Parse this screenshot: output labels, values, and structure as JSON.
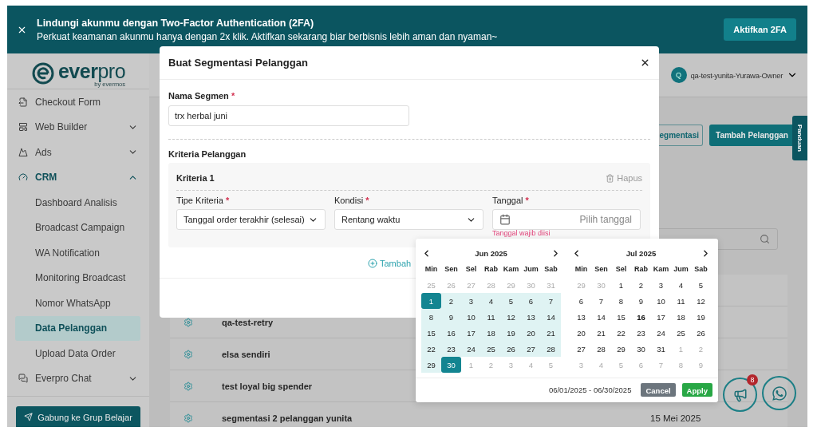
{
  "banner": {
    "title": "Lindungi akunmu dengan Two-Factor Authentication (2FA)",
    "message": "Perkuat keamanan akunmu hanya dengan 2x klik. Aktifkan sekarang biar berbisnis lebih aman dan nyaman~",
    "button": "Aktifkan 2FA"
  },
  "sidebar": {
    "logo": "**ever**pro",
    "tagline": "by evermos",
    "items": [
      {
        "kind": "link",
        "label": "Checkout Form"
      },
      {
        "kind": "group",
        "label": "Web Builder",
        "expanded": false
      },
      {
        "kind": "group",
        "label": "Ads",
        "expanded": false
      },
      {
        "kind": "group",
        "label": "CRM",
        "expanded": true,
        "children": [
          {
            "label": "Dashboard Analisis",
            "selected": false
          },
          {
            "label": "Broadcast Campaign",
            "selected": false
          },
          {
            "label": "WA Notification",
            "selected": false
          },
          {
            "label": "Monitoring Broadcast",
            "selected": false
          },
          {
            "label": "Nomor WhatsApp",
            "selected": false
          },
          {
            "label": "Data Pelanggan",
            "selected": true
          },
          {
            "label": "Upload Data Order",
            "selected": false
          }
        ]
      },
      {
        "kind": "group",
        "label": "Everpro Chat",
        "expanded": false
      }
    ],
    "join_button": "Gabung ke Grup Belajar"
  },
  "header": {
    "initial": "Q",
    "user": "qa-test-yunita-Yurawa-Owner"
  },
  "actions": [
    {
      "kind": "outline",
      "label": "egmentasi"
    },
    {
      "kind": "primary",
      "label": "Tambah Pelanggan"
    }
  ],
  "guide_tab": "Panduan",
  "rows": [
    {
      "name": "qa-test-retry"
    },
    {
      "name": "elsa sendiri"
    },
    {
      "name": "test loyal big spender"
    },
    {
      "name": "segmentasi 2 pelanggan yunita",
      "date": "15 Mei 2025"
    }
  ],
  "notification_badge": "8",
  "modal": {
    "title": "Buat Segmentasi Pelanggan",
    "name_field": {
      "label": "Nama Segmen",
      "mark": "*",
      "value": "trx herbal juni"
    },
    "criteria_title": "Kriteria Pelanggan",
    "criteria": [
      {
        "title": "Kriteria 1",
        "delete": "Hapus",
        "fields": [
          {
            "kind": "select",
            "label": "Tipe Kriteria",
            "mark": "*",
            "value": "Tanggal order terakhir (selesai)"
          },
          {
            "kind": "select",
            "label": "Kondisi",
            "mark": "*",
            "value": "Rentang waktu"
          },
          {
            "kind": "date",
            "label": "Tanggal",
            "mark": "*",
            "placeholder": "Pilih tanggal",
            "error": "Tanggal wajib diisi"
          }
        ]
      }
    ],
    "add_link": "Tambah"
  },
  "datepicker": {
    "months": [
      {
        "title": "Jun 2025",
        "weekdays": [
          "Min",
          "Sen",
          "Sel",
          "Rab",
          "Kam",
          "Jum",
          "Sab"
        ],
        "days": [
          {
            "d": "25",
            "kind": "outside"
          },
          {
            "d": "26",
            "kind": "outside"
          },
          {
            "d": "27",
            "kind": "outside"
          },
          {
            "d": "28",
            "kind": "outside"
          },
          {
            "d": "29",
            "kind": "outside"
          },
          {
            "d": "30",
            "kind": "outside"
          },
          {
            "d": "31",
            "kind": "outside"
          },
          {
            "d": "1",
            "kind": "selected"
          },
          {
            "d": "2",
            "kind": "range"
          },
          {
            "d": "3",
            "kind": "range"
          },
          {
            "d": "4",
            "kind": "range"
          },
          {
            "d": "5",
            "kind": "range"
          },
          {
            "d": "6",
            "kind": "range"
          },
          {
            "d": "7",
            "kind": "range"
          },
          {
            "d": "8",
            "kind": "range"
          },
          {
            "d": "9",
            "kind": "range"
          },
          {
            "d": "10",
            "kind": "range"
          },
          {
            "d": "11",
            "kind": "range"
          },
          {
            "d": "12",
            "kind": "range"
          },
          {
            "d": "13",
            "kind": "range"
          },
          {
            "d": "14",
            "kind": "range"
          },
          {
            "d": "15",
            "kind": "range"
          },
          {
            "d": "16",
            "kind": "range"
          },
          {
            "d": "17",
            "kind": "range"
          },
          {
            "d": "18",
            "kind": "range"
          },
          {
            "d": "19",
            "kind": "range"
          },
          {
            "d": "20",
            "kind": "range"
          },
          {
            "d": "21",
            "kind": "range"
          },
          {
            "d": "22",
            "kind": "range"
          },
          {
            "d": "23",
            "kind": "range"
          },
          {
            "d": "24",
            "kind": "range"
          },
          {
            "d": "25",
            "kind": "range"
          },
          {
            "d": "26",
            "kind": "range"
          },
          {
            "d": "27",
            "kind": "range"
          },
          {
            "d": "28",
            "kind": "range"
          },
          {
            "d": "29",
            "kind": "range"
          },
          {
            "d": "30",
            "kind": "selected"
          },
          {
            "d": "1",
            "kind": "outside"
          },
          {
            "d": "2",
            "kind": "outside"
          },
          {
            "d": "3",
            "kind": "outside"
          },
          {
            "d": "4",
            "kind": "outside"
          },
          {
            "d": "5",
            "kind": "outside"
          }
        ]
      },
      {
        "title": "Jul 2025",
        "weekdays": [
          "Min",
          "Sen",
          "Sel",
          "Rab",
          "Kam",
          "Jum",
          "Sab"
        ],
        "days": [
          {
            "d": "29",
            "kind": "outside"
          },
          {
            "d": "30",
            "kind": "outside"
          },
          {
            "d": "1",
            "kind": "normal"
          },
          {
            "d": "2",
            "kind": "normal"
          },
          {
            "d": "3",
            "kind": "normal"
          },
          {
            "d": "4",
            "kind": "normal"
          },
          {
            "d": "5",
            "kind": "normal"
          },
          {
            "d": "6",
            "kind": "normal"
          },
          {
            "d": "7",
            "kind": "normal"
          },
          {
            "d": "8",
            "kind": "normal"
          },
          {
            "d": "9",
            "kind": "normal"
          },
          {
            "d": "10",
            "kind": "normal"
          },
          {
            "d": "11",
            "kind": "normal"
          },
          {
            "d": "12",
            "kind": "normal"
          },
          {
            "d": "13",
            "kind": "normal"
          },
          {
            "d": "14",
            "kind": "normal"
          },
          {
            "d": "15",
            "kind": "normal"
          },
          {
            "d": "16",
            "kind": "today"
          },
          {
            "d": "17",
            "kind": "normal"
          },
          {
            "d": "18",
            "kind": "normal"
          },
          {
            "d": "19",
            "kind": "normal"
          },
          {
            "d": "20",
            "kind": "normal"
          },
          {
            "d": "21",
            "kind": "normal"
          },
          {
            "d": "22",
            "kind": "normal"
          },
          {
            "d": "23",
            "kind": "normal"
          },
          {
            "d": "24",
            "kind": "normal"
          },
          {
            "d": "25",
            "kind": "normal"
          },
          {
            "d": "26",
            "kind": "normal"
          },
          {
            "d": "27",
            "kind": "normal"
          },
          {
            "d": "28",
            "kind": "normal"
          },
          {
            "d": "29",
            "kind": "normal"
          },
          {
            "d": "30",
            "kind": "normal"
          },
          {
            "d": "31",
            "kind": "normal"
          },
          {
            "d": "1",
            "kind": "outside"
          },
          {
            "d": "2",
            "kind": "outside"
          },
          {
            "d": "3",
            "kind": "outside"
          },
          {
            "d": "4",
            "kind": "outside"
          },
          {
            "d": "5",
            "kind": "outside"
          },
          {
            "d": "6",
            "kind": "outside"
          },
          {
            "d": "7",
            "kind": "outside"
          },
          {
            "d": "8",
            "kind": "outside"
          },
          {
            "d": "9",
            "kind": "outside"
          }
        ]
      }
    ],
    "range_text": "06/01/2025 - 06/30/2025",
    "cancel": "Cancel",
    "apply": "Apply"
  }
}
